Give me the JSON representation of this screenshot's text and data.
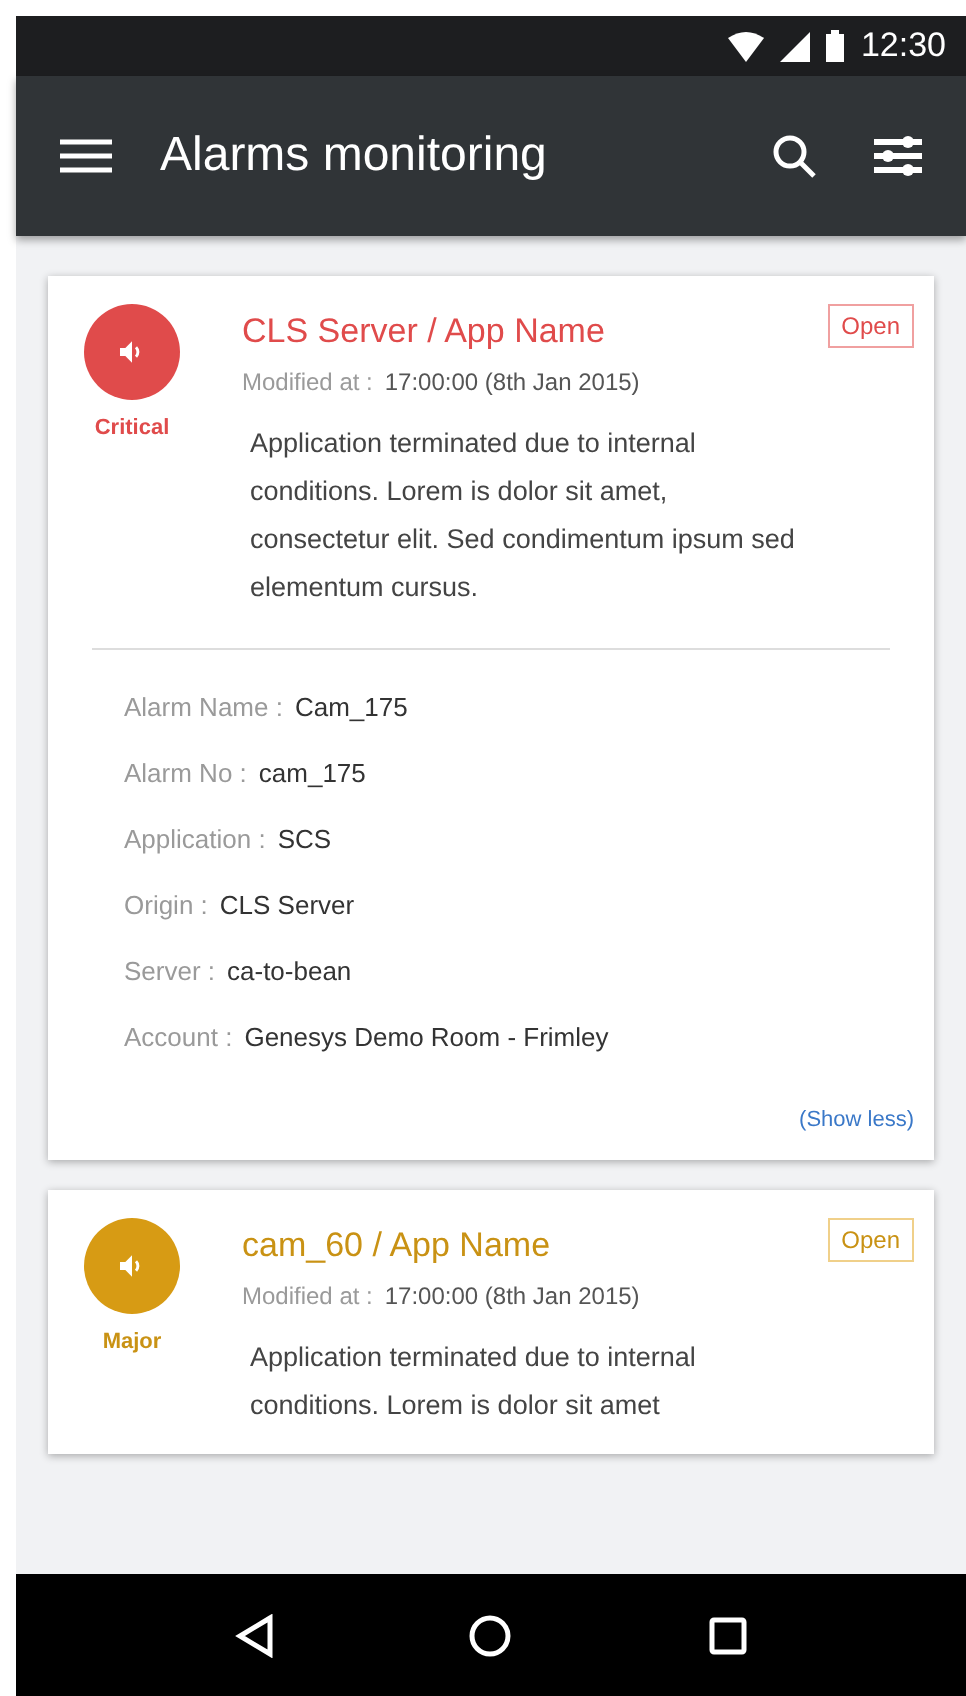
{
  "status_bar": {
    "time": "12:30"
  },
  "app_bar": {
    "title": "Alarms monitoring"
  },
  "alarms": [
    {
      "kind": "critical",
      "severity": "Critical",
      "title": "CLS Server / App Name",
      "status": "Open",
      "modified_label": "Modified at :",
      "modified_value": "17:00:00  (8th Jan 2015)",
      "description": "Application terminated due to internal conditions. Lorem is dolor sit amet, consectetur  elit. Sed condimentum ipsum sed elementum cursus.",
      "details": [
        {
          "label": "Alarm Name :",
          "value": "Cam_175"
        },
        {
          "label": "Alarm No :",
          "value": "cam_175"
        },
        {
          "label": "Application :",
          "value": "SCS"
        },
        {
          "label": "Origin :",
          "value": "CLS Server"
        },
        {
          "label": "Server :",
          "value": "ca-to-bean"
        },
        {
          "label": "Account :",
          "value": "Genesys Demo Room - Frimley"
        }
      ],
      "toggle": "(Show less)"
    },
    {
      "kind": "major",
      "severity": "Major",
      "title": "cam_60 / App Name",
      "status": "Open",
      "modified_label": "Modified at :",
      "modified_value": "17:00:00  (8th Jan 2015)",
      "description": "Application terminated due to internal conditions. Lorem is dolor sit amet"
    }
  ]
}
